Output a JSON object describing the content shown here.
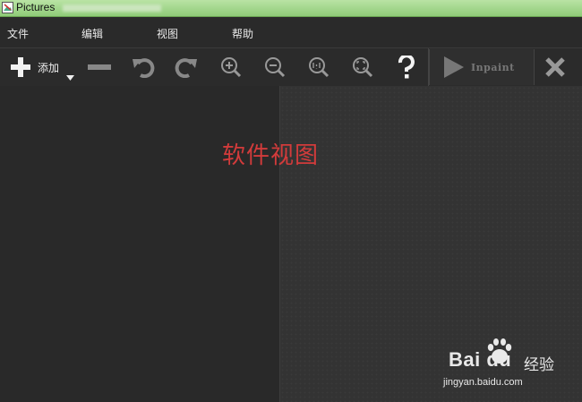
{
  "window": {
    "title": "Pictures"
  },
  "menu": {
    "items": [
      "文件",
      "编辑",
      "视图",
      "帮助"
    ]
  },
  "toolbar": {
    "add_label": "添加",
    "inpaint_label": "Inpaint",
    "icons": [
      "plus-icon",
      "minus-icon",
      "undo-icon",
      "redo-icon",
      "zoom-in-icon",
      "zoom-out-icon",
      "actual-size-icon",
      "fit-screen-icon",
      "help-icon",
      "play-icon",
      "close-icon"
    ]
  },
  "canvas": {
    "annotation": "软件视图"
  },
  "watermark": {
    "brand": "Bai du",
    "cn": "经验",
    "url": "jingyan.baidu.com"
  },
  "colors": {
    "annotation": "#d23b3b",
    "titlebar": "#a6d890",
    "background": "#2a2a2a"
  }
}
